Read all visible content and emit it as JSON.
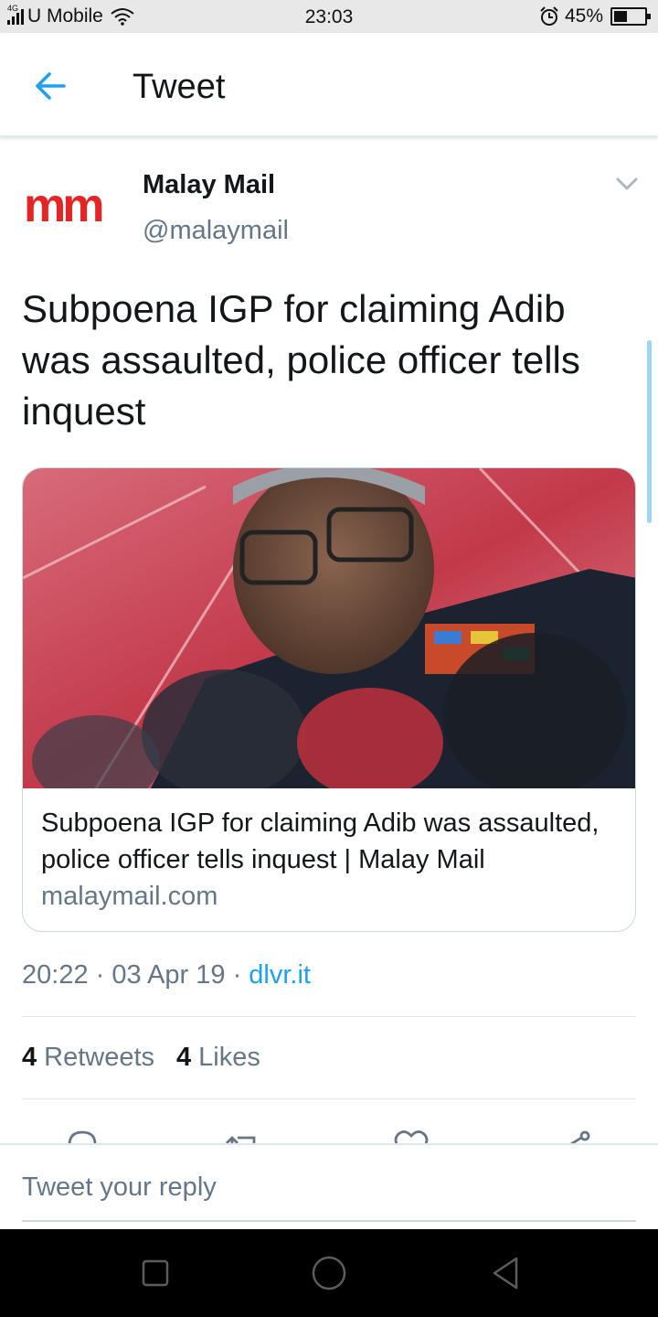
{
  "status_bar": {
    "network": "4G",
    "carrier": "U Mobile",
    "time": "23:03",
    "battery": "45%",
    "battery_level": 0.45
  },
  "header": {
    "title": "Tweet",
    "back_icon": "arrow-left-icon"
  },
  "tweet": {
    "avatar_text": "mm",
    "display_name": "Malay Mail",
    "handle": "@malaymail",
    "text": "Subpoena IGP for claiming Adib was assaulted, police officer tells inquest",
    "card": {
      "title": "Subpoena IGP for claiming Adib was assaulted, police officer tells inquest | Malay Mail",
      "domain": "malaymail.com"
    },
    "time": "20:22",
    "date": "03 Apr 19",
    "source": "dlvr.it",
    "retweets_count": "4",
    "retweets_label": "Retweets",
    "likes_count": "4",
    "likes_label": "Likes"
  },
  "actions": [
    "reply-icon",
    "retweet-icon",
    "heart-icon",
    "share-icon"
  ],
  "reply": {
    "placeholder": "Tweet your reply"
  },
  "colors": {
    "accent": "#1da1f2",
    "secondary_text": "#657786",
    "brand_red": "#e32526"
  }
}
